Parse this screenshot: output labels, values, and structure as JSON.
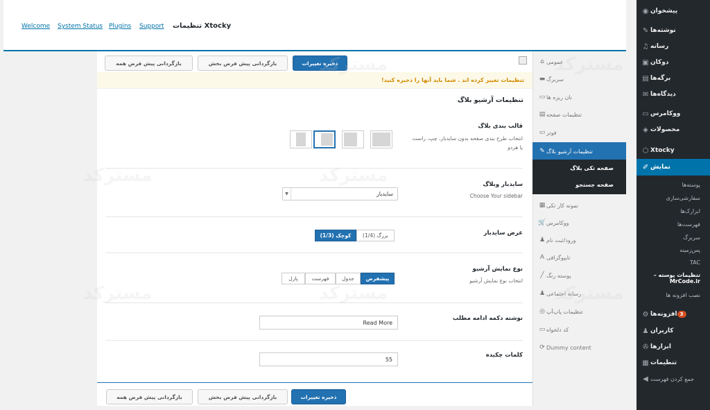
{
  "wp_menu": {
    "items": [
      {
        "label": "پیشخوان",
        "icon": "dashboard-icon",
        "glyph": "◉"
      },
      {
        "label": "نوشته‌ها",
        "icon": "pin-icon",
        "glyph": "✎"
      },
      {
        "label": "رسانه",
        "icon": "media-icon",
        "glyph": "♫"
      },
      {
        "label": "دوکان",
        "icon": "store-icon",
        "glyph": "▣"
      },
      {
        "label": "برگه‌ها",
        "icon": "page-icon",
        "glyph": "▤"
      },
      {
        "label": "دیدگاه‌ها",
        "icon": "comment-icon",
        "glyph": "✉"
      },
      {
        "label": "ووکامرس",
        "icon": "woocommerce-icon",
        "glyph": "▭"
      },
      {
        "label": "محصولات",
        "icon": "products-icon",
        "glyph": "◈"
      },
      {
        "label": "Xtocky",
        "icon": "xtocky-icon",
        "glyph": "⬡"
      },
      {
        "label": "نمایش",
        "icon": "appearance-icon",
        "glyph": "✐"
      }
    ],
    "subitems": [
      "پوسته‌ها",
      "سفارشی‌سازی",
      "ابزارک‌ها",
      "فهرست‌ها",
      "سربرگ",
      "پس‌زمینه",
      "TAC",
      "تنظیمات پوسته – MrCode.ir",
      "نصب افزونه ها"
    ],
    "bottom": [
      {
        "label": "افزونه‌ها",
        "icon": "plugins-icon",
        "glyph": "⚙",
        "badge": "3"
      },
      {
        "label": "کاربران",
        "icon": "users-icon",
        "glyph": "♟"
      },
      {
        "label": "ابزارها",
        "icon": "tools-icon",
        "glyph": "✇"
      },
      {
        "label": "تنظیمات",
        "icon": "settings-icon",
        "glyph": "▦"
      },
      {
        "label": "جمع کردن فهرست",
        "icon": "collapse-icon",
        "glyph": "◀"
      }
    ]
  },
  "top": {
    "links": [
      "Welcome",
      "System Status",
      "Plugins",
      "Support"
    ],
    "brand_title": "تنظیمات",
    "brand_name": "Xtocky"
  },
  "tabs": [
    {
      "label": "عمومی",
      "icon": "home-icon",
      "glyph": "⌂",
      "arrow": "⌄"
    },
    {
      "label": "سربرگ",
      "icon": "header-icon",
      "glyph": "▬",
      "arrow": "⌄"
    },
    {
      "label": "نان ریزه ها",
      "icon": "breadcrumb-icon",
      "glyph": "▭"
    },
    {
      "label": "تنظیمات صفحه",
      "icon": "page-settings-icon",
      "glyph": "▤"
    },
    {
      "label": "فوتر",
      "icon": "footer-icon",
      "glyph": "▭",
      "arrow": "⌄"
    },
    {
      "label": "تنظیمات آرشیو بلاگ",
      "icon": "blog-icon",
      "glyph": "✎",
      "active": true
    },
    {
      "label": "نمونه کار تکی",
      "icon": "portfolio-icon",
      "glyph": "▦"
    },
    {
      "label": "ووکامرس",
      "icon": "cart-icon",
      "glyph": "🛒",
      "arrow": "⌄"
    },
    {
      "label": "ورود/ثبت نام",
      "icon": "user-icon",
      "glyph": "♟"
    },
    {
      "label": "تایپوگرافی",
      "icon": "typography-icon",
      "glyph": "A"
    },
    {
      "label": "پوسته رنگ",
      "icon": "brush-icon",
      "glyph": "╱"
    },
    {
      "label": "رسانه اجتماعی",
      "icon": "social-icon",
      "glyph": "♟",
      "arrow": "⌄"
    },
    {
      "label": "تنظیمات پاپ‌آپ",
      "icon": "popup-icon",
      "glyph": "◎"
    },
    {
      "label": "کد دلخواه",
      "icon": "code-icon",
      "glyph": "▭"
    },
    {
      "label": "Dummy content",
      "icon": "refresh-icon",
      "glyph": "⟳"
    }
  ],
  "subtabs": [
    "صفحه تکی بلاگ",
    "صفحه جستجو"
  ],
  "buttons": {
    "save": "ذخیره تغییرات",
    "reset_section": "بازگردانی پیش فرض بخش",
    "reset_all": "بازگردانی پیش فرض همه"
  },
  "notice": "تنظیمات تغییر کرده اند . شما باید آنها را ذخیره کنید!",
  "section_title": "تنظیمات آرشیو بلاگ",
  "fields": {
    "layout": {
      "label": "قالب بندی بلاگ",
      "desc1": "انتخاب طرح بندی صفحه بدون سایدبار، چپ، راست",
      "desc2": "یا هردو"
    },
    "sidebar": {
      "label": "سایدبار وبلاگ",
      "desc": "Choose Your sidebar",
      "value": "سایدبار"
    },
    "sidebar_width": {
      "label": "عرض سایدبار",
      "options": [
        "بزرگ (1/4)",
        "کوچک (1/3)"
      ],
      "selected": 1
    },
    "archive_type": {
      "label": "نوع نمایش آرشیو",
      "desc": "انتخاب نوع نمایش آرشیو",
      "options": [
        "پیشفرض",
        "جدول",
        "فهرست",
        "پازل"
      ],
      "selected": 0
    },
    "read_more": {
      "label": "نوشته دکمه ادامه مطلب",
      "value": "Read More"
    },
    "excerpt": {
      "label": "کلمات چکیده",
      "value": "55"
    }
  },
  "watermark": "مسترکد"
}
